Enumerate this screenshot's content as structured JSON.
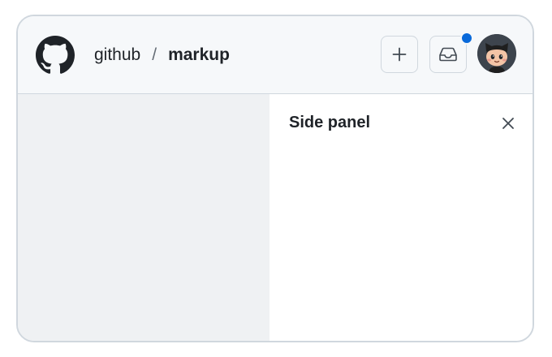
{
  "header": {
    "logo_icon": "github-mark-icon",
    "breadcrumb": {
      "owner": "github",
      "separator": "/",
      "repo": "markup"
    },
    "actions": {
      "create_icon": "plus-icon",
      "inbox_icon": "inbox-icon",
      "inbox_has_unread": true,
      "avatar_icon": "octocat-avatar"
    }
  },
  "side_panel": {
    "title": "Side panel",
    "close_icon": "x-icon"
  },
  "colors": {
    "header_bg": "#f6f8fa",
    "border": "#d0d7de",
    "content_bg": "#eff1f3",
    "accent": "#0969da",
    "text": "#1f2328"
  }
}
